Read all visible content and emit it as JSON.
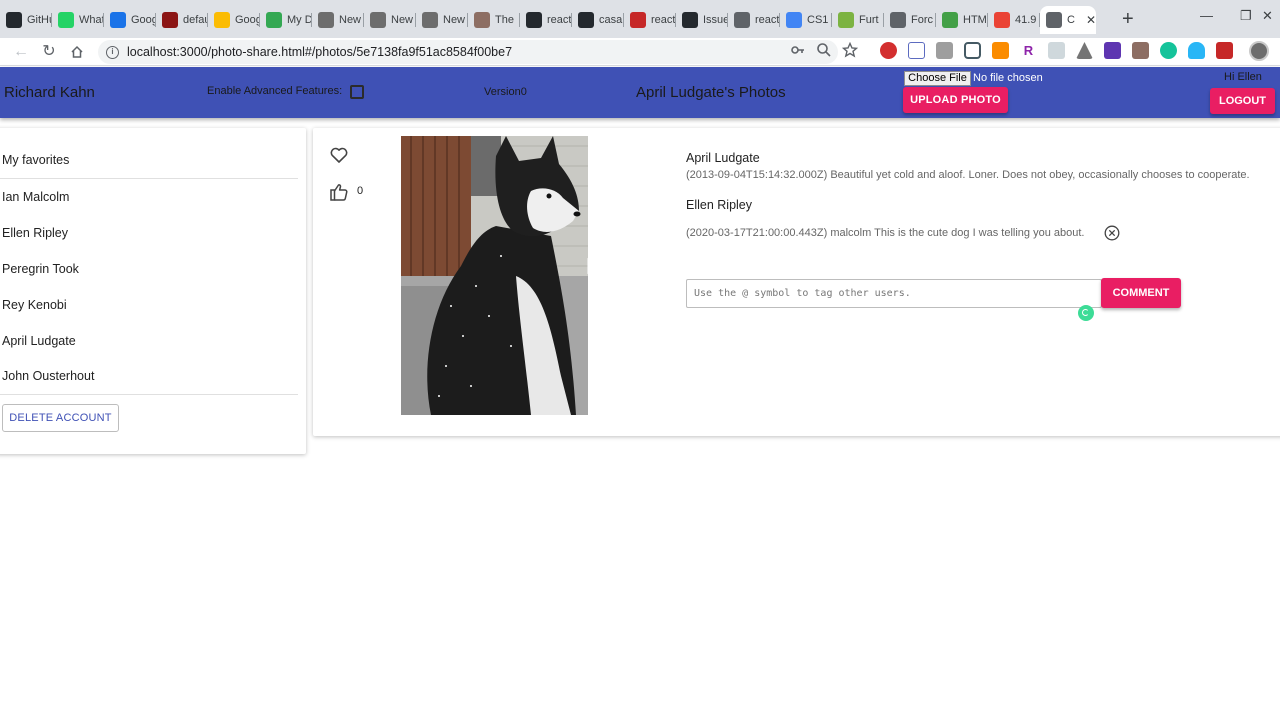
{
  "browser": {
    "tabs": [
      {
        "title": "GitHub",
        "icon": "github-icon",
        "color": "#24292e"
      },
      {
        "title": "WhatsApp",
        "icon": "whatsapp-icon",
        "color": "#25d366"
      },
      {
        "title": "Google Calendar",
        "icon": "calendar-icon",
        "color": "#1a73e8"
      },
      {
        "title": "default",
        "icon": "stanford-icon",
        "color": "#8c1515"
      },
      {
        "title": "Google Keep",
        "icon": "keep-icon",
        "color": "#fbbc04"
      },
      {
        "title": "My Drive",
        "icon": "drive-icon",
        "color": "#34a853"
      },
      {
        "title": "New",
        "icon": "library-icon",
        "color": "#6d6d6d"
      },
      {
        "title": "New",
        "icon": "library-icon",
        "color": "#6d6d6d"
      },
      {
        "title": "New",
        "icon": "library-icon",
        "color": "#6d6d6d"
      },
      {
        "title": "The",
        "icon": "books-icon",
        "color": "#8d6e63"
      },
      {
        "title": "react",
        "icon": "github-icon",
        "color": "#24292e"
      },
      {
        "title": "casa",
        "icon": "github-icon",
        "color": "#24292e"
      },
      {
        "title": "react",
        "icon": "app-icon",
        "color": "#c62828"
      },
      {
        "title": "Issues",
        "icon": "github-icon",
        "color": "#24292e"
      },
      {
        "title": "react",
        "icon": "globe-icon",
        "color": "#5f6368"
      },
      {
        "title": "CS1",
        "icon": "docs-icon",
        "color": "#4285f4"
      },
      {
        "title": "Furt",
        "icon": "r-icon",
        "color": "#7cb342"
      },
      {
        "title": "Forc",
        "icon": "globe-icon",
        "color": "#5f6368"
      },
      {
        "title": "HTM",
        "icon": "html-icon",
        "color": "#43a047"
      },
      {
        "title": "41.9",
        "icon": "maps-icon",
        "color": "#ea4335"
      },
      {
        "title": "C",
        "icon": "globe-icon",
        "color": "#5f6368",
        "active": true
      }
    ],
    "new_tab": "+",
    "url": "localhost:3000/photo-share.html#/photos/5e7138fa9f51ac8584f00be7"
  },
  "app": {
    "user_name": "Richard Kahn",
    "advanced_label": "Enable Advanced Features:",
    "version": "Version0",
    "title": "April Ludgate's Photos",
    "choose_file": "Choose File",
    "no_file": "No file chosen",
    "upload": "UPLOAD PHOTO",
    "greeting": "Hi Ellen",
    "logout": "LOGOUT",
    "accent": "#3f51b5",
    "button_color": "#e91e63"
  },
  "sidebar": {
    "favorites": "My favorites",
    "users": [
      "Ian Malcolm",
      "Ellen Ripley",
      "Peregrin Took",
      "Rey Kenobi",
      "April Ludgate",
      "John Ousterhout"
    ],
    "delete_account": "DELETE ACCOUNT"
  },
  "photo": {
    "likes": "0",
    "comments": [
      {
        "author": "April Ludgate",
        "text": "(2013-09-04T15:14:32.000Z) Beautiful yet cold and aloof. Loner. Does not obey, occasionally chooses to cooperate."
      },
      {
        "author": "Ellen Ripley",
        "text": "(2020-03-17T21:00:00.443Z) malcolm This is the cute dog I was telling you about."
      }
    ],
    "comment_placeholder": "Use the @ symbol to tag other users.",
    "comment_button": "COMMENT"
  }
}
